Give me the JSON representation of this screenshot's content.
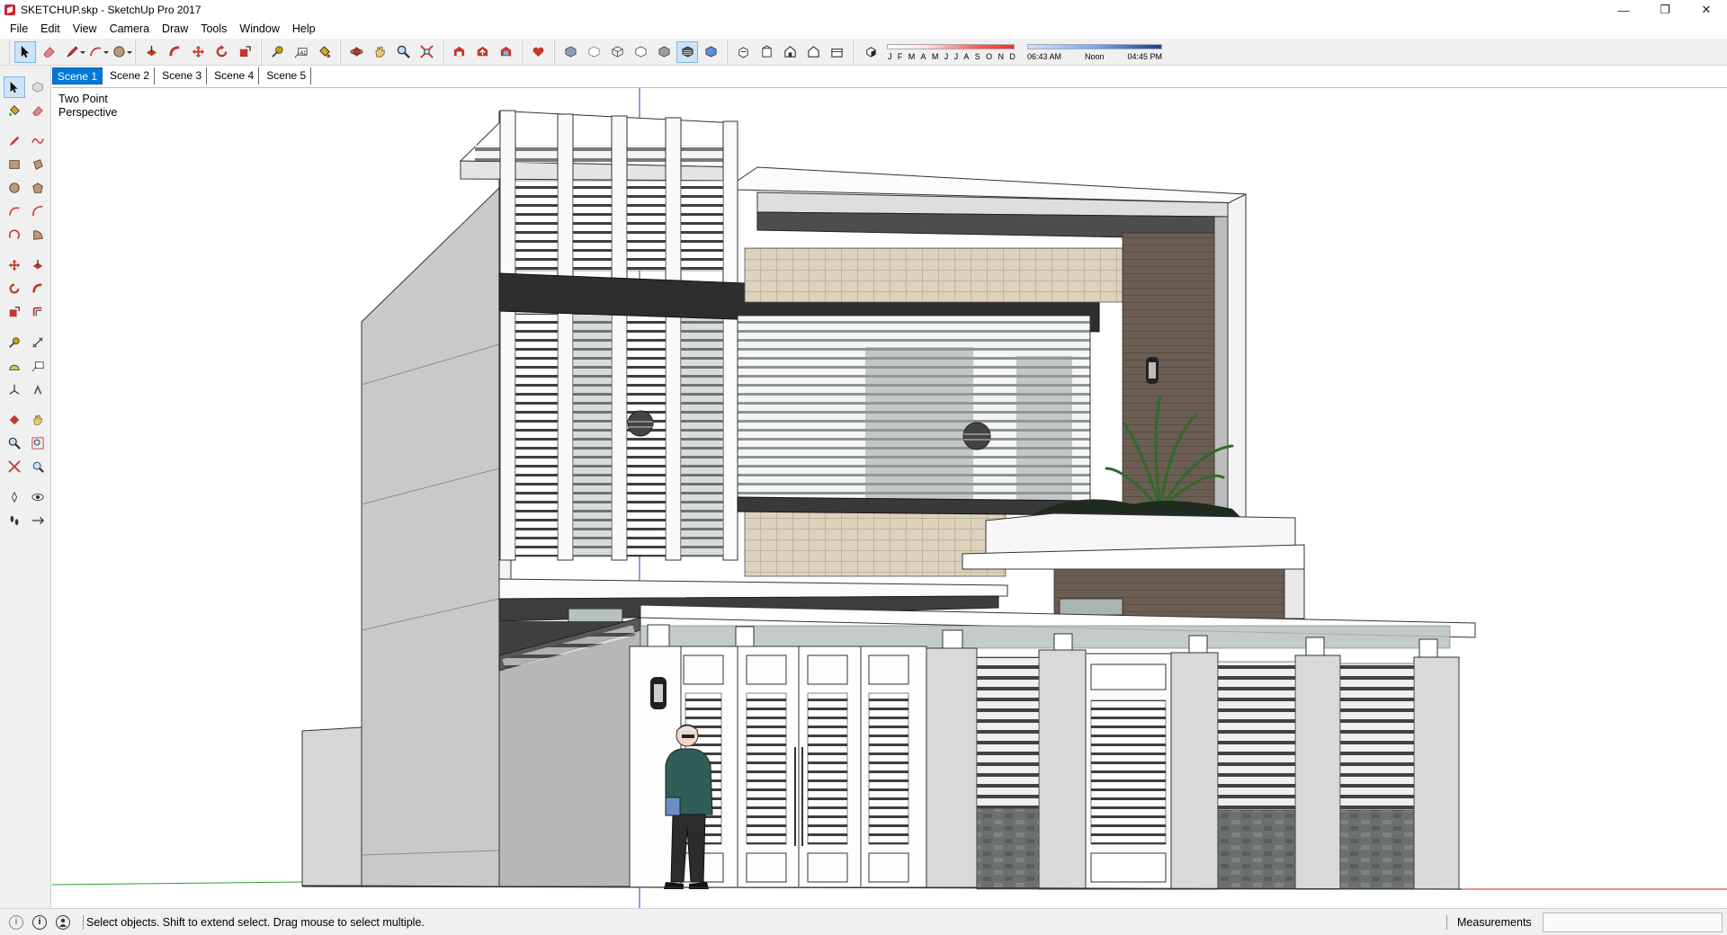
{
  "window": {
    "title": "SKETCHUP.skp - SketchUp Pro 2017",
    "controls": [
      "—",
      "❐",
      "✕"
    ]
  },
  "menu": [
    "File",
    "Edit",
    "View",
    "Camera",
    "Draw",
    "Tools",
    "Window",
    "Help"
  ],
  "shadow_settings": {
    "months": [
      "J",
      "F",
      "M",
      "A",
      "M",
      "J",
      "J",
      "A",
      "S",
      "O",
      "N",
      "D"
    ],
    "time_start": "06:43 AM",
    "time_mid": "Noon",
    "time_end": "04:45 PM"
  },
  "scenes": {
    "tabs": [
      "Scene 1",
      "Scene 2",
      "Scene 3",
      "Scene 4",
      "Scene 5"
    ],
    "active": "Scene 1"
  },
  "viewport": {
    "camera_label": "Two Point\nPerspective"
  },
  "status": {
    "hint": "Select objects. Shift to extend select. Drag mouse to select multiple.",
    "measurements_label": "Measurements",
    "measurements_value": ""
  },
  "colors": {
    "accent": "#0078d7",
    "toolbar_bg": "#f0f0f0",
    "wall_light": "#d9d9d9",
    "wall_dark": "#4a4a4a",
    "wood": "#6b5a4c",
    "stone_tile": "#d9cdb5",
    "glass": "#b8c4c2"
  }
}
